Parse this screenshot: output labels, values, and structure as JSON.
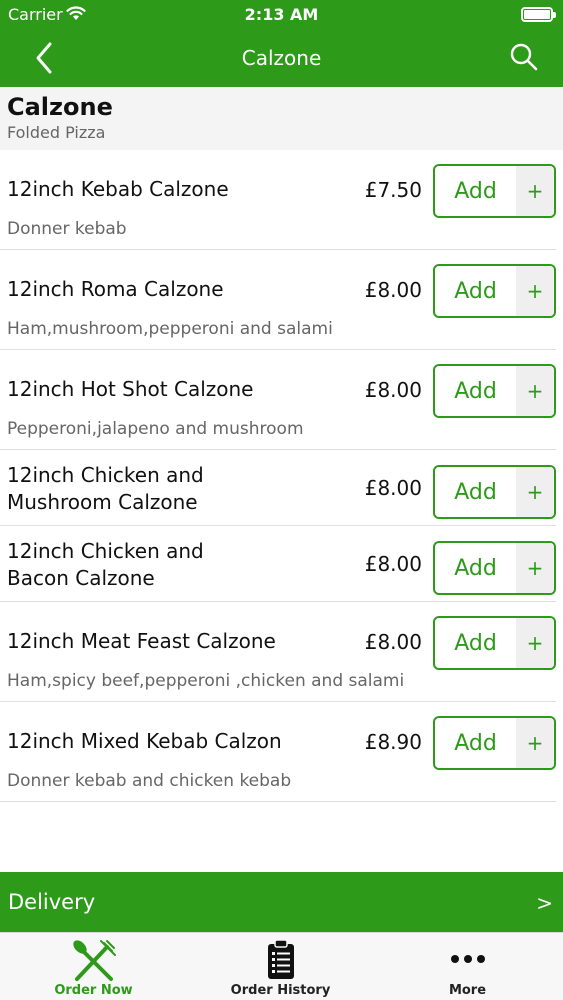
{
  "status_bar": {
    "carrier": "Carrier",
    "time": "2:13 AM"
  },
  "nav": {
    "title": "Calzone",
    "back_icon": "chevron-left-icon",
    "search_icon": "search-icon"
  },
  "category": {
    "title": "Calzone",
    "subtitle": "Folded Pizza"
  },
  "items": [
    {
      "name": "12inch Kebab Calzone",
      "price": "£7.50",
      "description": "Donner kebab",
      "add_label": "Add",
      "plus_label": "+"
    },
    {
      "name": "12inch Roma Calzone",
      "price": "£8.00",
      "description": "Ham,mushroom,pepperoni and salami",
      "add_label": "Add",
      "plus_label": "+"
    },
    {
      "name": "12inch Hot Shot Calzone",
      "price": "£8.00",
      "description": "Pepperoni,jalapeno  and mushroom",
      "add_label": "Add",
      "plus_label": "+"
    },
    {
      "name_line1": "12inch Chicken and",
      "name_line2": "Mushroom Calzone",
      "price": "£8.00",
      "add_label": "Add",
      "plus_label": "+"
    },
    {
      "name_line1": "12inch Chicken and",
      "name_line2": "Bacon Calzone",
      "price": "£8.00",
      "add_label": "Add",
      "plus_label": "+"
    },
    {
      "name": "12inch Meat Feast Calzone",
      "price": "£8.00",
      "description": "Ham,spicy beef,pepperoni ,chicken and salami",
      "add_label": "Add",
      "plus_label": "+"
    },
    {
      "name": "12inch Mixed Kebab Calzon",
      "price": "£8.90",
      "description": "Donner kebab and chicken kebab",
      "add_label": "Add",
      "plus_label": "+"
    }
  ],
  "delivery": {
    "label": "Delivery",
    "arrow": ">"
  },
  "tabs": [
    {
      "label": "Order Now",
      "icon": "fork-knife-icon",
      "active": true
    },
    {
      "label": "Order History",
      "icon": "clipboard-list-icon",
      "active": false
    },
    {
      "label": "More",
      "icon": "more-dots-icon",
      "active": false
    }
  ],
  "colors": {
    "accent": "#2e9a1a",
    "secondary_text": "#666666"
  }
}
